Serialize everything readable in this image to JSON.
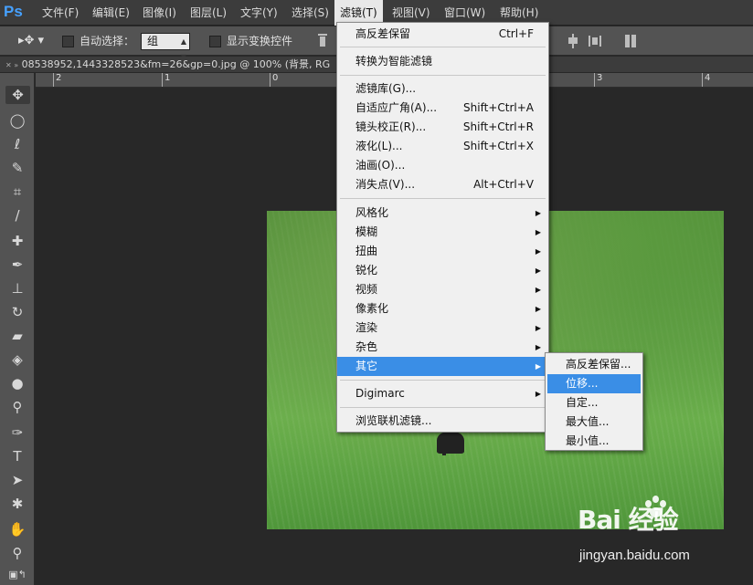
{
  "app": {
    "logo": "Ps"
  },
  "menubar": {
    "items": [
      "文件(F)",
      "编辑(E)",
      "图像(I)",
      "图层(L)",
      "文字(Y)",
      "选择(S)",
      "滤镜(T)",
      "视图(V)",
      "窗口(W)",
      "帮助(H)"
    ],
    "active_index": 6
  },
  "options": {
    "auto_select_label": "自动选择：",
    "group_value": "组",
    "show_transform_label": "显示变换控件"
  },
  "tab": {
    "title": "08538952,1443328523&fm=26&gp=0.jpg @ 100% (背景, RG"
  },
  "ruler": {
    "labels": [
      "2",
      "1",
      "0",
      "1",
      "2",
      "3",
      "4"
    ]
  },
  "filter_menu": {
    "items": [
      {
        "label": "高反差保留",
        "shortcut": "Ctrl+F"
      },
      {
        "label": "转换为智能滤镜",
        "shortcut": ""
      },
      {
        "label": "滤镜库(G)...",
        "shortcut": ""
      },
      {
        "label": "自适应广角(A)...",
        "shortcut": "Shift+Ctrl+A"
      },
      {
        "label": "镜头校正(R)...",
        "shortcut": "Shift+Ctrl+R"
      },
      {
        "label": "液化(L)...",
        "shortcut": "Shift+Ctrl+X"
      },
      {
        "label": "油画(O)...",
        "shortcut": ""
      },
      {
        "label": "消失点(V)...",
        "shortcut": "Alt+Ctrl+V"
      },
      {
        "label": "风格化",
        "shortcut": ""
      },
      {
        "label": "模糊",
        "shortcut": ""
      },
      {
        "label": "扭曲",
        "shortcut": ""
      },
      {
        "label": "锐化",
        "shortcut": ""
      },
      {
        "label": "视频",
        "shortcut": ""
      },
      {
        "label": "像素化",
        "shortcut": ""
      },
      {
        "label": "渲染",
        "shortcut": ""
      },
      {
        "label": "杂色",
        "shortcut": ""
      },
      {
        "label": "其它",
        "shortcut": ""
      },
      {
        "label": "Digimarc",
        "shortcut": ""
      },
      {
        "label": "浏览联机滤镜...",
        "shortcut": ""
      }
    ],
    "highlight_index": 16
  },
  "submenu": {
    "items": [
      "高反差保留...",
      "位移...",
      "自定...",
      "最大值...",
      "最小值..."
    ],
    "highlight_index": 1
  },
  "watermark": {
    "brand": "Bai 经验",
    "url": "jingyan.baidu.com"
  },
  "colors": {
    "accent": "#3a8ee6",
    "menubar": "#3c3c3c",
    "panel": "#535353",
    "canvas": "#282828"
  }
}
